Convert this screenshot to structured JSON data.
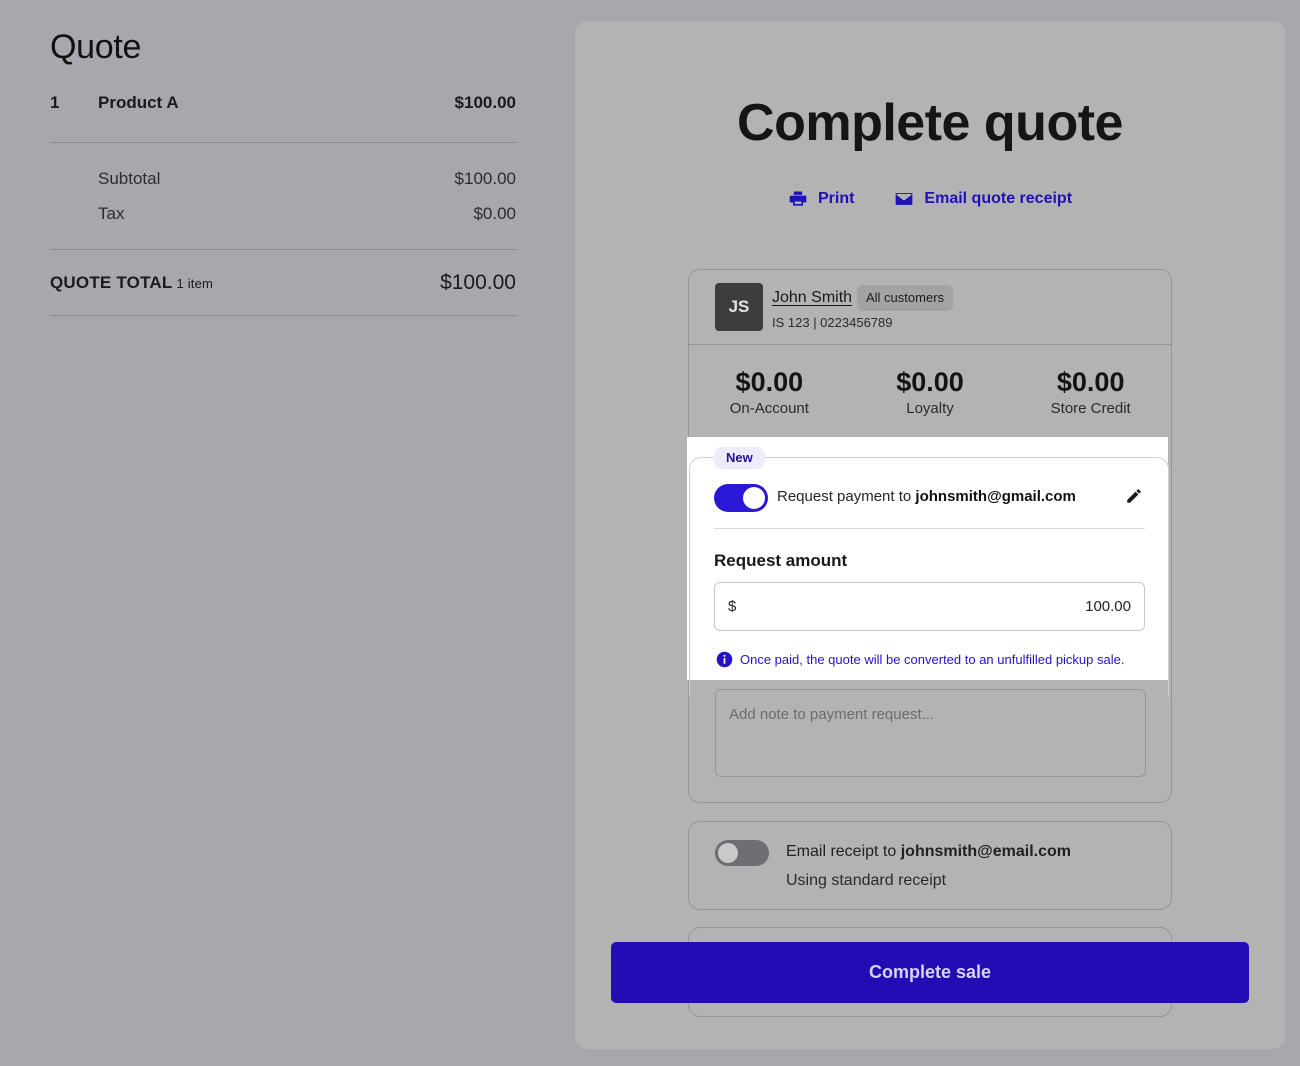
{
  "quote": {
    "title": "Quote",
    "line_items": [
      {
        "qty": "1",
        "name": "Product A",
        "price": "$100.00"
      }
    ],
    "subtotal_label": "Subtotal",
    "subtotal_value": "$100.00",
    "tax_label": "Tax",
    "tax_value": "$0.00",
    "total_label": "QUOTE TOTAL",
    "total_items": "1 item",
    "total_value": "$100.00"
  },
  "complete": {
    "title": "Complete quote",
    "print_label": "Print",
    "email_receipt_label": "Email quote receipt",
    "customer": {
      "initials": "JS",
      "name": "John Smith",
      "group": "All customers",
      "id_line": "IS 123 | 0223456789"
    },
    "balances": [
      {
        "amount": "$0.00",
        "label": "On-Account"
      },
      {
        "amount": "$0.00",
        "label": "Loyalty"
      },
      {
        "amount": "$0.00",
        "label": "Store Credit"
      }
    ],
    "request_payment": {
      "badge": "New",
      "prefix": "Request payment to ",
      "email": "johnsmith@gmail.com",
      "enabled": true,
      "amount_label": "Request amount",
      "currency": "$",
      "amount": "100.00",
      "info": "Once paid, the quote will be converted to an unfulfilled pickup sale."
    },
    "note_placeholder": "Add note to payment request...",
    "email_receipt": {
      "prefix": "Email receipt to ",
      "email": "johnsmith@email.com",
      "sub": "Using standard receipt",
      "enabled": false
    },
    "complete_button": "Complete sale"
  },
  "colors": {
    "accent": "#220db5",
    "link": "#1f10b8",
    "overlay": "#a7a7ad"
  }
}
